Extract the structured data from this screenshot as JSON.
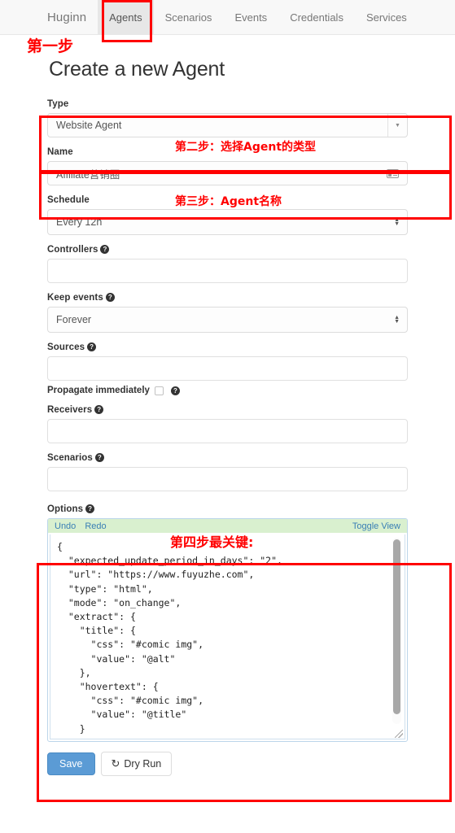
{
  "navbar": {
    "brand": "Huginn",
    "items": [
      {
        "label": "Agents",
        "active": true
      },
      {
        "label": "Scenarios",
        "active": false
      },
      {
        "label": "Events",
        "active": false
      },
      {
        "label": "Credentials",
        "active": false
      },
      {
        "label": "Services",
        "active": false
      }
    ]
  },
  "annotations": {
    "step1": "第一步",
    "step2": "第二步：选择Agent的类型",
    "step3": "第三步：Agent名称",
    "step4": "第四步最关键:",
    "color": "#ff0000"
  },
  "page": {
    "title": "Create a new Agent"
  },
  "form": {
    "type": {
      "label": "Type",
      "value": "Website Agent",
      "caret": "chevron-down-icon"
    },
    "name": {
      "label": "Name",
      "value": "Affiliate营销圈",
      "placeholder": "",
      "icon": "contact-card-icon"
    },
    "schedule": {
      "label": "Schedule",
      "value": "Every 12h"
    },
    "controllers": {
      "label": "Controllers",
      "value": "",
      "help": "?"
    },
    "keep_events": {
      "label": "Keep events",
      "value": "Forever",
      "help": "?"
    },
    "sources": {
      "label": "Sources",
      "value": "",
      "help": "?"
    },
    "propagate": {
      "label": "Propagate immediately",
      "checked": false,
      "help": "?"
    },
    "receivers": {
      "label": "Receivers",
      "value": "",
      "help": "?"
    },
    "scenarios": {
      "label": "Scenarios",
      "value": "",
      "help": "?"
    },
    "options": {
      "label": "Options",
      "help": "?",
      "toolbar": {
        "undo": "Undo",
        "redo": "Redo",
        "toggle_view": "Toggle View"
      },
      "code": "{\n  \"expected_update_period_in_days\": \"2\",\n  \"url\": \"https://www.fuyuzhe.com\",\n  \"type\": \"html\",\n  \"mode\": \"on_change\",\n  \"extract\": {\n    \"title\": {\n      \"css\": \"#comic img\",\n      \"value\": \"@alt\"\n    },\n    \"hovertext\": {\n      \"css\": \"#comic img\",\n      \"value\": \"@title\"\n    }\n  }\n}"
    }
  },
  "footer": {
    "save_label": "Save",
    "dry_run_label": "Dry Run",
    "dry_run_icon": "refresh-icon",
    "save_color": "#5b9bd5"
  }
}
